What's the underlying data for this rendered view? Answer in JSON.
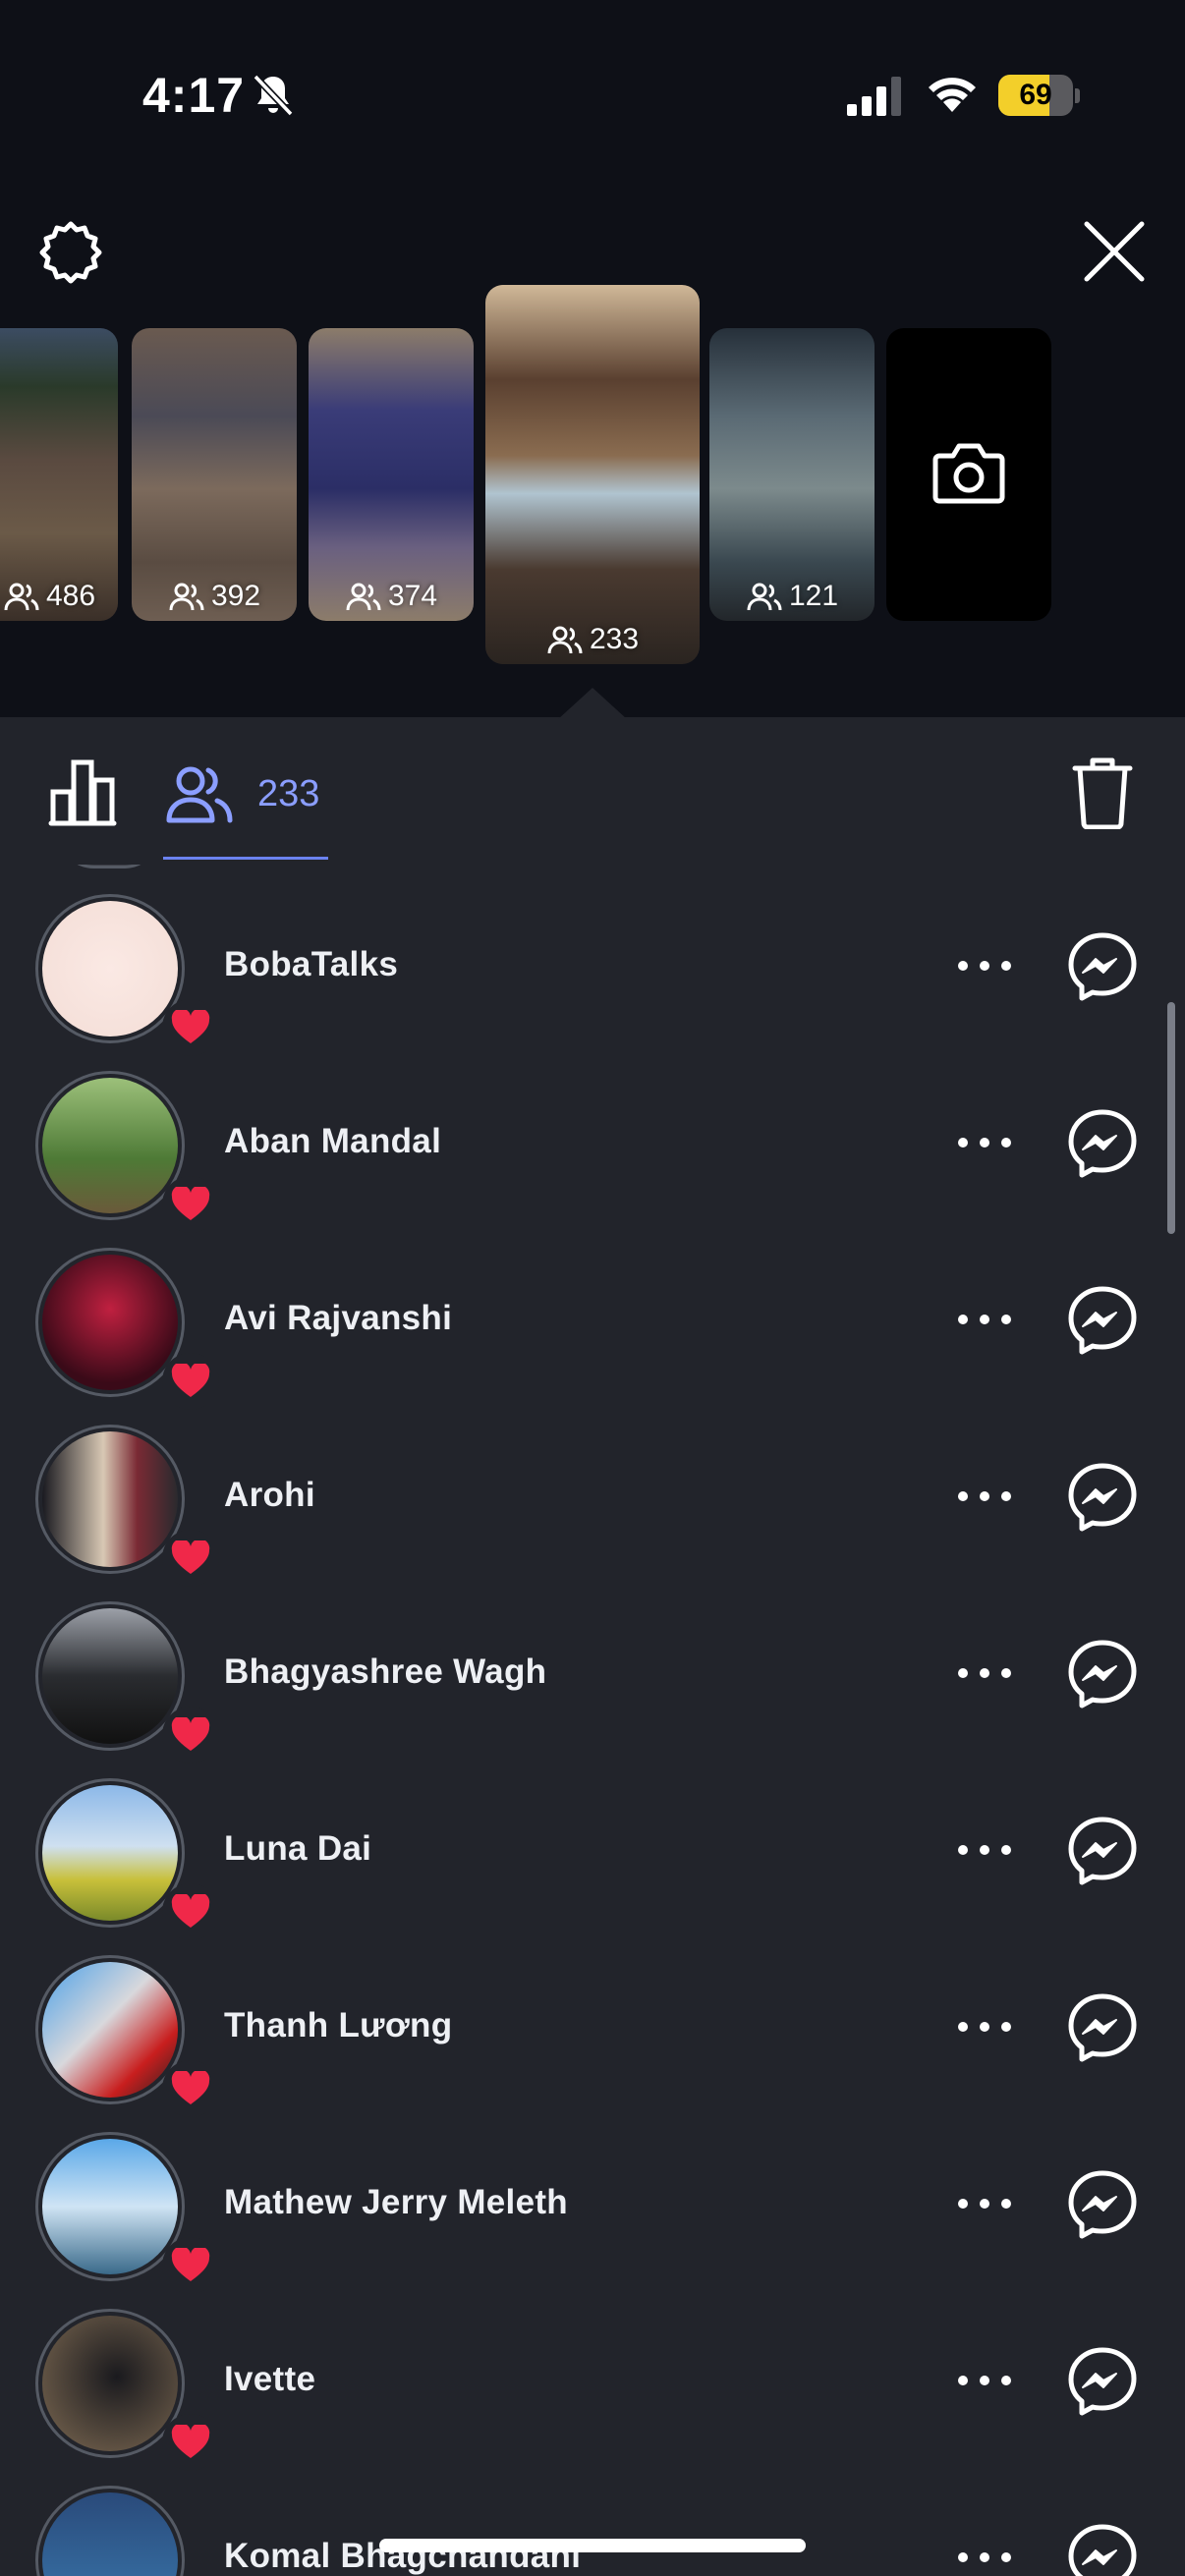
{
  "status_bar": {
    "time": "4:17",
    "battery_level": "69",
    "battery_fraction": 0.69,
    "icons": [
      "bell-slash-icon",
      "cellular-signal-icon",
      "wifi-icon",
      "battery-icon"
    ]
  },
  "header": {
    "settings_icon": "gear-icon",
    "close_icon": "close-icon"
  },
  "stories": [
    {
      "viewer_count": "486",
      "selected": false
    },
    {
      "viewer_count": "392",
      "selected": false
    },
    {
      "viewer_count": "374",
      "selected": false
    },
    {
      "viewer_count": "233",
      "selected": true
    },
    {
      "viewer_count": "121",
      "selected": false
    },
    {
      "type": "add-story",
      "icon": "camera-icon"
    }
  ],
  "viewer_bar": {
    "stats_icon": "bar-chart-icon",
    "viewers_icon": "people-icon",
    "viewers_count": "233",
    "delete_icon": "trash-icon"
  },
  "viewers": [
    {
      "name": "BobaTalks",
      "reaction": "heart-icon"
    },
    {
      "name": "Aban Mandal",
      "reaction": "heart-icon"
    },
    {
      "name": "Avi Rajvanshi",
      "reaction": "heart-icon"
    },
    {
      "name": "Arohi",
      "reaction": "heart-icon"
    },
    {
      "name": "Bhagyashree Wagh",
      "reaction": "heart-icon"
    },
    {
      "name": "Luna Dai",
      "reaction": "heart-icon"
    },
    {
      "name": "Thanh Lương",
      "reaction": "heart-icon"
    },
    {
      "name": "Mathew Jerry Meleth",
      "reaction": "heart-icon"
    },
    {
      "name": "Ivette",
      "reaction": "heart-icon"
    },
    {
      "name": "Komal Bhagchandani",
      "reaction": ""
    }
  ],
  "colors": {
    "background": "#22242b",
    "top_background": "#0e1017",
    "accent": "#8b9eff",
    "heart": "#f02849",
    "battery": "#f3cf2a"
  }
}
